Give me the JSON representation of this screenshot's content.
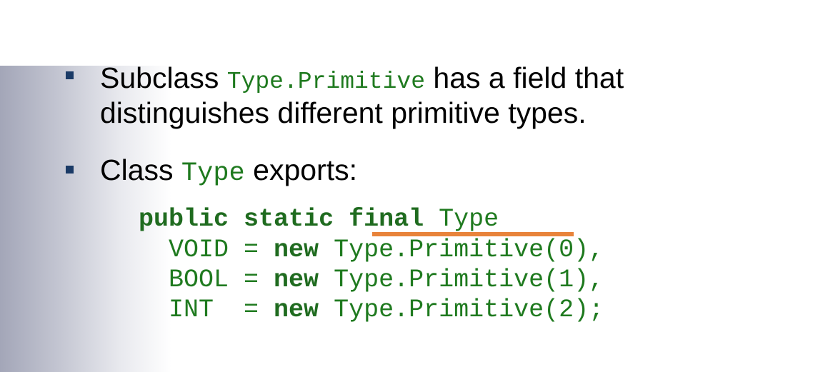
{
  "bullets": [
    {
      "text_a": "Subclass ",
      "code_a": "Type.Primitive",
      "text_b": " has a field that",
      "text_c": "distinguishes different primitive types."
    },
    {
      "text_a": "Class ",
      "code_a": "Type",
      "text_b": " exports:"
    }
  ],
  "code": {
    "kw_public": "public",
    "kw_static": "static",
    "kw_final": "final",
    "type_name": "Type",
    "lines": [
      {
        "name": "VOID",
        "eq": " = ",
        "kw": "new",
        "rest": " Type.Primitive(0),",
        "pad": "  "
      },
      {
        "name": "BOOL",
        "eq": " = ",
        "kw": "new",
        "rest": " Type.Primitive(1),",
        "pad": "  "
      },
      {
        "name": "INT",
        "eq": "  = ",
        "kw": "new",
        "rest": " Type.Primitive(2);",
        "pad": "  "
      }
    ]
  },
  "colors": {
    "code_green": "#1f7a1f",
    "bullet_blue": "#1a3a66",
    "highlight_orange": "#e8833a"
  }
}
